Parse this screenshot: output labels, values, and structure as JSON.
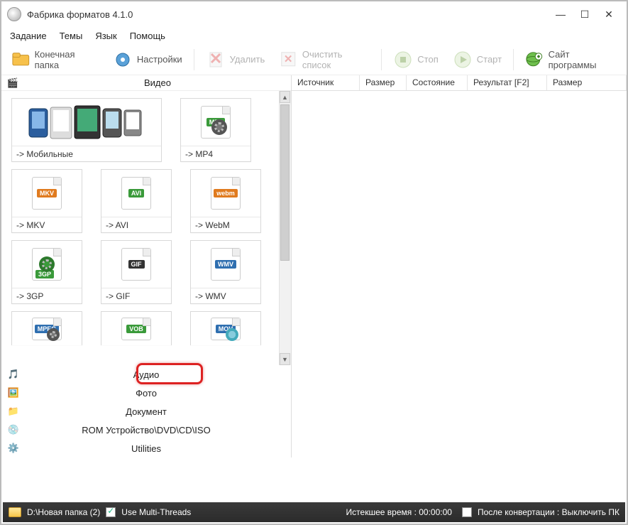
{
  "window": {
    "title": "Фабрика форматов 4.1.0"
  },
  "menu": {
    "task": "Задание",
    "themes": "Темы",
    "lang": "Язык",
    "help": "Помощь"
  },
  "toolbar": {
    "outfolder": "Конечная папка",
    "settings": "Настройки",
    "delete": "Удалить",
    "clear": "Очистить список",
    "stop": "Стоп",
    "start": "Старт",
    "site": "Сайт программы"
  },
  "categories": {
    "video": "Видео",
    "audio": "Аудио",
    "photo": "Фото",
    "doc": "Документ",
    "rom": "ROM Устройство\\DVD\\CD\\ISO",
    "util": "Utilities"
  },
  "tiles": {
    "mobile": "->  Мобильные",
    "mp4": "->  MP4",
    "mkv": "->  MKV",
    "avi": "->  AVI",
    "webm": "->  WebM",
    "3gp": "->  3GP",
    "gif": "->  GIF",
    "wmv": "->  WMV"
  },
  "badges": {
    "mp4": "MP4",
    "mkv": "MKV",
    "avi": "AVI",
    "webm": "webm",
    "3gp": "3GP",
    "gif": "GIF",
    "wmv": "WMV",
    "mpeg": "MPEG",
    "vob": "VOB",
    "mov": "MOV"
  },
  "table": {
    "src": "Источник",
    "size": "Размер",
    "state": "Состояние",
    "result": "Результат [F2]",
    "size2": "Размер"
  },
  "status": {
    "path": "D:\\Новая папка (2)",
    "multithreads": "Use Multi-Threads",
    "elapsed": "Истекшее время : 00:00:00",
    "afterconv": "После конвертации : Выключить ПК"
  }
}
